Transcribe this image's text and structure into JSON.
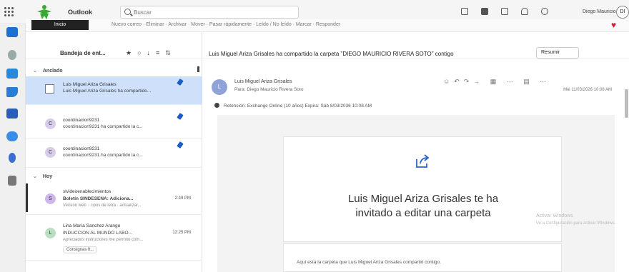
{
  "app": {
    "title": "Outlook"
  },
  "search": {
    "placeholder": "Buscar"
  },
  "user": {
    "name": "Diego Mauricio R...",
    "initials": "DI"
  },
  "ribbon": {
    "active_tab": "Inicio",
    "items": "Nuevo correo  ·  Eliminar  ·  Archivar  ·  Mover  ·  Pasar rápidamente  ·  Leído / No leído  ·  Marcar  ·  Responder",
    "heart_color": "#c4243a"
  },
  "list": {
    "folder_title": "Bandeja de ent...",
    "groups": {
      "pinned": "Anclado",
      "today": "Hoy"
    },
    "pinned": [
      {
        "sender": "Luis Miguel Ariza Grisales",
        "subject": "Luis Miguel Ariza Grisales ha compartido...",
        "initial": ""
      },
      {
        "sender": "coordinacion9231",
        "subject": "coordinacion9231 ha compartido la c...",
        "initial": "C"
      },
      {
        "sender": "coordinacion9231",
        "subject": "coordinacion9231 ha compartido la c...",
        "initial": "C"
      }
    ],
    "today": [
      {
        "sender": "slvideoenablecimientos",
        "subject": "Boletín SINDESENA: Adiciona...",
        "preview": "Versión web · Tipos de letra · actualizar...",
        "time": "2:49 PM",
        "initial": "S"
      },
      {
        "sender": "Lina María Sanchez Arango",
        "subject": "INDUCCIÓN AL MUNDO LABO...",
        "preview": "Apreciados instructores me permito com...",
        "time": "12:25 PM",
        "initial": "L",
        "attachment": "Consignas ft..."
      }
    ]
  },
  "reading": {
    "subject": "Luis Miguel Ariza Grisales ha compartido la carpeta \"DIEGO MAURICIO RIVERA SOTO\" contigo",
    "summary_button": "Resumir",
    "from": "Luis Miguel Ariza Grisales",
    "to": "Para: Diego Mauricio Rivera Soto",
    "date": "Mié 11/03/2026 10:08 AM",
    "avatar_initial": "L",
    "retention": "Retención: Exchange Online (10 años) Expira: Sáb 8/03/2036 10:08 AM",
    "invite_line1": "Luis Miguel Ariza Grisales te ha",
    "invite_line2": "invitado a editar una carpeta",
    "folder_text": "Aquí está la carpeta que Luis Miguel Ariza Grisales compartió contigo.",
    "watermark_line1": "Activar Windows",
    "watermark_line2": "Ve a Configuración para activar Windows."
  }
}
